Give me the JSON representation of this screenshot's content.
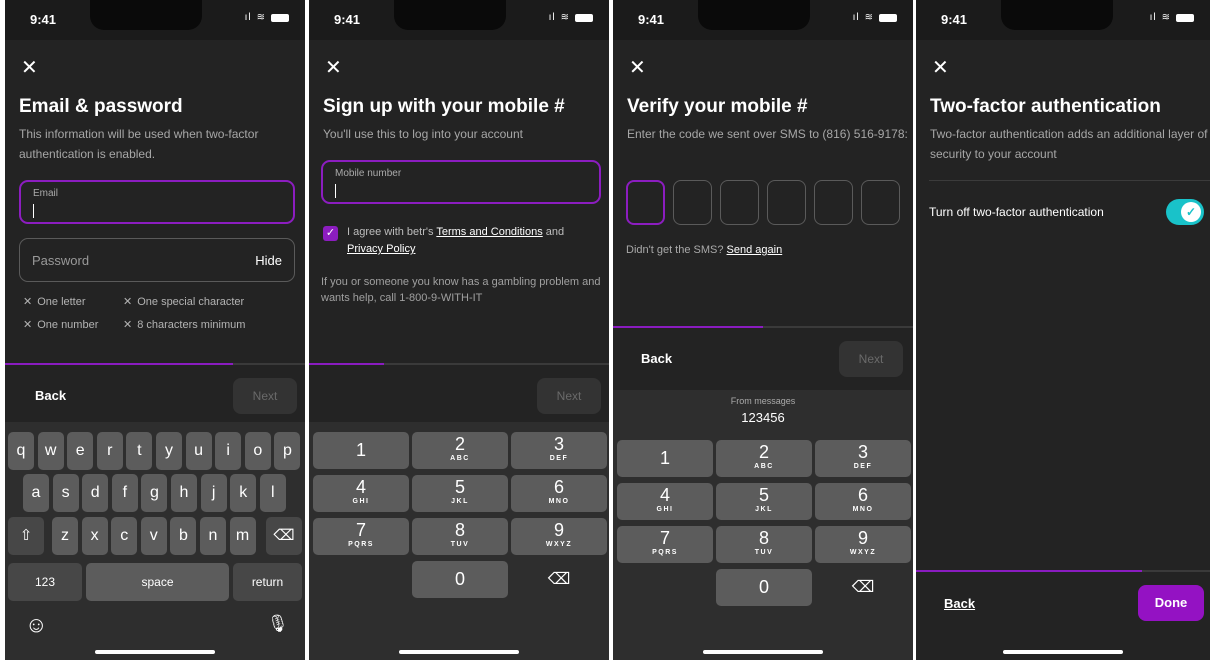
{
  "status_bar": {
    "time": "9:41",
    "signal": "ıl",
    "wifi": "≋"
  },
  "colors": {
    "accent": "#8c1dc0",
    "toggle_on": "#19c2c9",
    "background": "#232323"
  },
  "screen1": {
    "close": "✕",
    "title": "Email & password",
    "subtitle": "This information will be used when two-factor authentication is enabled.",
    "email_label": "Email",
    "password_placeholder": "Password",
    "hide_label": "Hide",
    "requirements": [
      "One letter",
      "One special character",
      "One number",
      "8 characters minimum"
    ],
    "progress": 0.76,
    "back_label": "Back",
    "next_label": "Next",
    "keyboard": {
      "row1": [
        "q",
        "w",
        "e",
        "r",
        "t",
        "y",
        "u",
        "i",
        "o",
        "p"
      ],
      "row2": [
        "a",
        "s",
        "d",
        "f",
        "g",
        "h",
        "j",
        "k",
        "l"
      ],
      "row3": [
        "z",
        "x",
        "c",
        "v",
        "b",
        "n",
        "m"
      ],
      "shift": "⇧",
      "backspace": "⌫",
      "numbers": "123",
      "space": "space",
      "return": "return",
      "emoji": "☺",
      "mic": "🎙"
    }
  },
  "screen2": {
    "close": "✕",
    "title": "Sign up with your mobile #",
    "subtitle": "You'll use this to log into your account",
    "mobile_label": "Mobile number",
    "check": "✓",
    "agree_prefix": "I agree with betr's ",
    "terms": "Terms and Conditions",
    "agree_and": " and ",
    "privacy": "Privacy Policy",
    "gambling": "If you or someone you know has a gambling problem and wants help, call 1-800-9-WITH-IT",
    "progress": 0.25,
    "next_label": "Next"
  },
  "numpad": [
    {
      "d": "1",
      "l": ""
    },
    {
      "d": "2",
      "l": "ABC"
    },
    {
      "d": "3",
      "l": "DEF"
    },
    {
      "d": "4",
      "l": "GHI"
    },
    {
      "d": "5",
      "l": "JKL"
    },
    {
      "d": "6",
      "l": "MNO"
    },
    {
      "d": "7",
      "l": "PQRS"
    },
    {
      "d": "8",
      "l": "TUV"
    },
    {
      "d": "9",
      "l": "WXYZ"
    }
  ],
  "numpad_zero": "0",
  "numpad_delete": "⌫",
  "screen3": {
    "close": "✕",
    "title": "Verify your mobile #",
    "subtitle": "Enter the code we sent over SMS to (816) 516-9178:",
    "resend_prefix": "Didn't get the SMS? ",
    "resend_link": "Send again",
    "progress": 0.5,
    "back_label": "Back",
    "next_label": "Next",
    "suggestion_label": "From messages",
    "suggestion_code": "123456"
  },
  "screen4": {
    "close": "✕",
    "title": "Two-factor authentication",
    "subtitle": "Two-factor authentication adds an additional layer of security to your account",
    "toggle_label": "Turn off two-factor authentication",
    "toggle_check": "✓",
    "toggle_on": true,
    "progress": 0.77,
    "back_label": "Back",
    "done_label": "Done"
  }
}
